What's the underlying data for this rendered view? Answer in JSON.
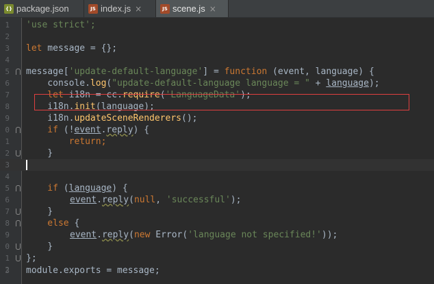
{
  "tabs": [
    {
      "label": "package.json",
      "icon": "json-file-icon",
      "active": false
    },
    {
      "label": "index.js",
      "icon": "js-file-icon",
      "active": false
    },
    {
      "label": "scene.js",
      "icon": "js-file-icon",
      "active": true
    }
  ],
  "close_glyph": "×",
  "line_numbers": [
    "1",
    "2",
    "3",
    "4",
    "5",
    "6",
    "7",
    "8",
    "9",
    "0",
    "1",
    "2",
    "3",
    "4",
    "5",
    "6",
    "7",
    "8",
    "9",
    "0",
    "1",
    "2",
    "3"
  ],
  "code": {
    "l1": "'use strict';",
    "l3_let": "let",
    "l3_rest": " message = {};",
    "l5_a": "message[",
    "l5_str": "'update-default-language'",
    "l5_b": "] = ",
    "l5_fn": "function",
    "l5_c": " (event, language) {",
    "l6_a": "    console.",
    "l6_log": "log",
    "l6_b": "(",
    "l6_str": "\"update-default-language language = \"",
    "l6_c": " + ",
    "l6_lang": "language",
    "l6_d": ");",
    "l7_let": "    let",
    "l7_a": " i18n = cc.",
    "l7_req": "require",
    "l7_b": "(",
    "l7_str": "'LanguageData'",
    "l7_c": ");",
    "l8_a": "    i18n.",
    "l8_init": "init",
    "l8_b": "(",
    "l8_lang": "language",
    "l8_c": ");",
    "l9_a": "    i18n.",
    "l9_fn": "updateSceneRenderers",
    "l9_b": "();",
    "l10_if": "    if",
    "l10_a": " (!",
    "l10_event": "event",
    "l10_dot": ".",
    "l10_reply": "reply",
    "l10_b": ") {",
    "l11_ret": "        return",
    "l11_a": ";",
    "l12": "    }",
    "l15_if": "    if",
    "l15_a": " (",
    "l15_lang": "language",
    "l15_b": ") {",
    "l16_event": "event",
    "l16_dot": ".",
    "l16_reply": "reply",
    "l16_a": "(",
    "l16_null": "null",
    "l16_b": ", ",
    "l16_str": "'successful'",
    "l16_c": ");",
    "l17": "    }",
    "l18_else": "    else",
    "l18_a": " {",
    "l19_event": "event",
    "l19_dot": ".",
    "l19_reply": "reply",
    "l19_a": "(",
    "l19_new": "new",
    "l19_b": " Error(",
    "l19_str": "'language not specified!'",
    "l19_c": "));",
    "l20": "    }",
    "l21": "};",
    "l23": "module.exports = message;"
  },
  "colors": {
    "keyword": "#cc7832",
    "string": "#6a8759",
    "function": "#ffc66d",
    "text": "#a9b7c6",
    "highlight_border": "#e04040"
  }
}
